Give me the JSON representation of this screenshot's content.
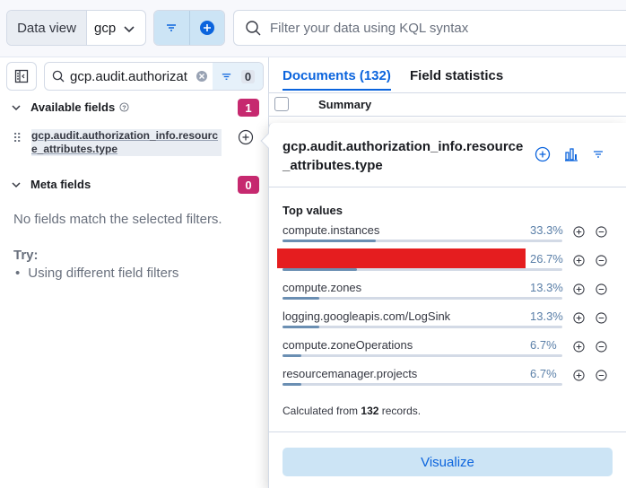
{
  "topbar": {
    "data_view_label": "Data view",
    "data_view_value": "gcp",
    "search_placeholder": "Filter your data using KQL syntax"
  },
  "sidebar": {
    "field_search_value": "gcp.audit.authorizat",
    "filter_count": "0",
    "available_fields": {
      "label": "Available fields",
      "count": "1"
    },
    "field_name": "gcp.audit.authorization_info.resource_attributes.type",
    "meta_fields": {
      "label": "Meta fields",
      "count": "0"
    },
    "empty_message": "No fields match the selected filters.",
    "try_label": "Try:",
    "try_items": [
      "Using different field filters"
    ]
  },
  "main": {
    "tabs": [
      {
        "label": "Documents (132)"
      },
      {
        "label": "Field statistics"
      }
    ],
    "grid_header": "Summary"
  },
  "popover": {
    "title": "gcp.audit.authorization_info.resource_attributes.type",
    "section_label": "Top values",
    "values": [
      {
        "name": "compute.instances",
        "pct_label": "33.3%",
        "pct": 0.333
      },
      {
        "name": "",
        "pct_label": "26.7%",
        "pct": 0.267
      },
      {
        "name": "compute.zones",
        "pct_label": "13.3%",
        "pct": 0.133
      },
      {
        "name": "logging.googleapis.com/LogSink",
        "pct_label": "13.3%",
        "pct": 0.133
      },
      {
        "name": "compute.zoneOperations",
        "pct_label": "6.7%",
        "pct": 0.067
      },
      {
        "name": "resourcemanager.projects",
        "pct_label": "6.7%",
        "pct": 0.067
      }
    ],
    "calc_prefix": "Calculated from",
    "calc_count": "132",
    "calc_suffix": "records.",
    "visualize_label": "Visualize"
  },
  "colors": {
    "accent": "#0b64dd",
    "badge": "#c6296f",
    "bar_fill": "#6b8fb3",
    "redaction": "#e51d1f"
  }
}
